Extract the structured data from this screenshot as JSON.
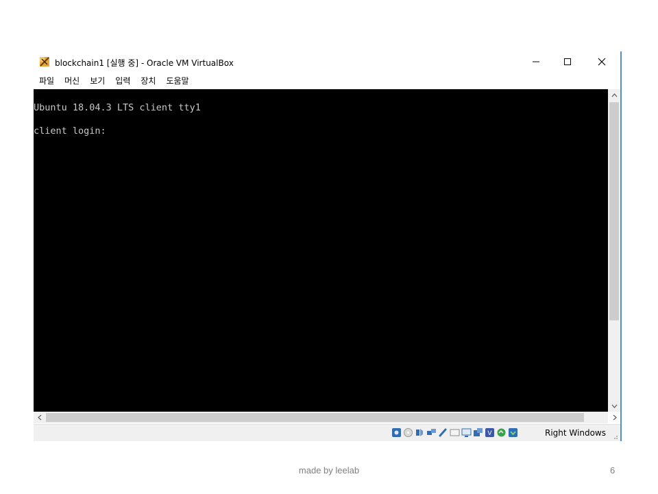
{
  "window": {
    "title": "blockchain1 [실행 중] - Oracle VM VirtualBox",
    "icon": "virtualbox-icon"
  },
  "menu": {
    "items": [
      {
        "label": "파일"
      },
      {
        "label": "머신"
      },
      {
        "label": "보기"
      },
      {
        "label": "입력"
      },
      {
        "label": "장치"
      },
      {
        "label": "도움말"
      }
    ]
  },
  "terminal": {
    "line1": "Ubuntu 18.04.3 LTS client tty1",
    "line2": "client login: "
  },
  "statusbar": {
    "host_key": "Right Windows",
    "icons": [
      "hard-disk-icon",
      "optical-drive-icon",
      "audio-icon",
      "network-icon",
      "usb-icon",
      "shared-folders-icon",
      "display-icon",
      "video-capture-icon",
      "cpu-icon",
      "mouse-integration-icon",
      "keyboard-icon"
    ]
  },
  "footer": {
    "credit": "made by leelab",
    "page_number": "6"
  },
  "colors": {
    "terminal_bg": "#000000",
    "terminal_fg": "#c8c8c8",
    "window_border": "#4a8fd8"
  }
}
